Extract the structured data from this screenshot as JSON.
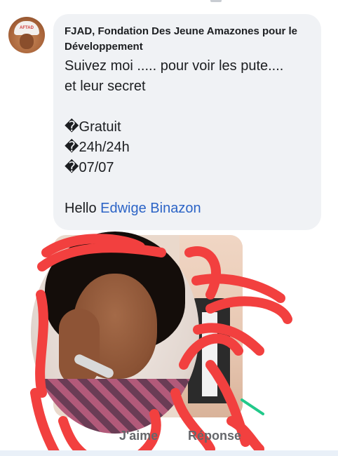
{
  "comment": {
    "author": "FJAD, Fondation Des Jeune Amazones pour le Développement",
    "avatar_icon": "organization-logo-avatar",
    "avatar_badge": "AFTAD",
    "lines": [
      "Suivez moi ..... pour voir les pute....",
      "et leur secret",
      "",
      "�Gratuit",
      "�24h/24h",
      "�07/07",
      "",
      "Hello "
    ],
    "mention": "Edwige Binazon",
    "mention_color": "#2c64c6"
  },
  "actions": {
    "like": "J'aime",
    "reply": "Réponse"
  },
  "colors": {
    "bubble": "#f0f2f5",
    "scribble": "#f2403f",
    "action_text": "#65676b"
  }
}
